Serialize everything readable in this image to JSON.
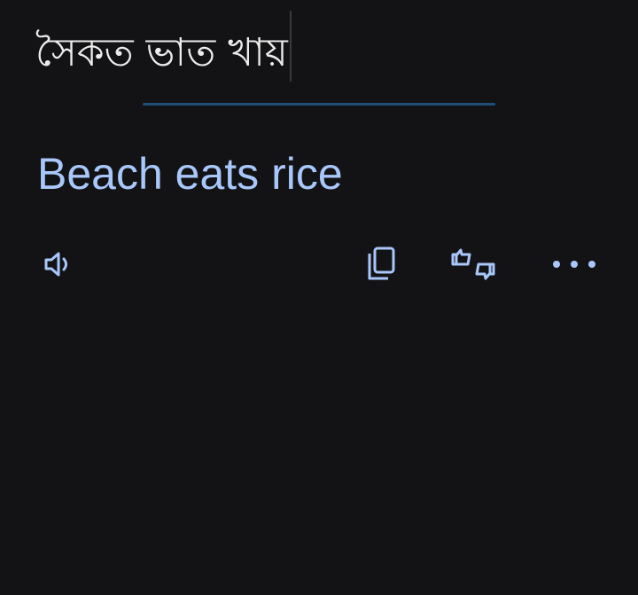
{
  "source": {
    "text": "সৈকত ভাত খায়"
  },
  "translation": {
    "text": "Beach eats rice"
  },
  "actions": {
    "speak_icon": "speaker-icon",
    "copy_icon": "copy-icon",
    "feedback_icon": "thumbs-up-down-icon",
    "more_icon": "more-horizontal-icon"
  },
  "colors": {
    "background": "#131315",
    "translation_text": "#a8c7fa",
    "icon": "#a8c7fa",
    "divider": "#1f4e78"
  }
}
